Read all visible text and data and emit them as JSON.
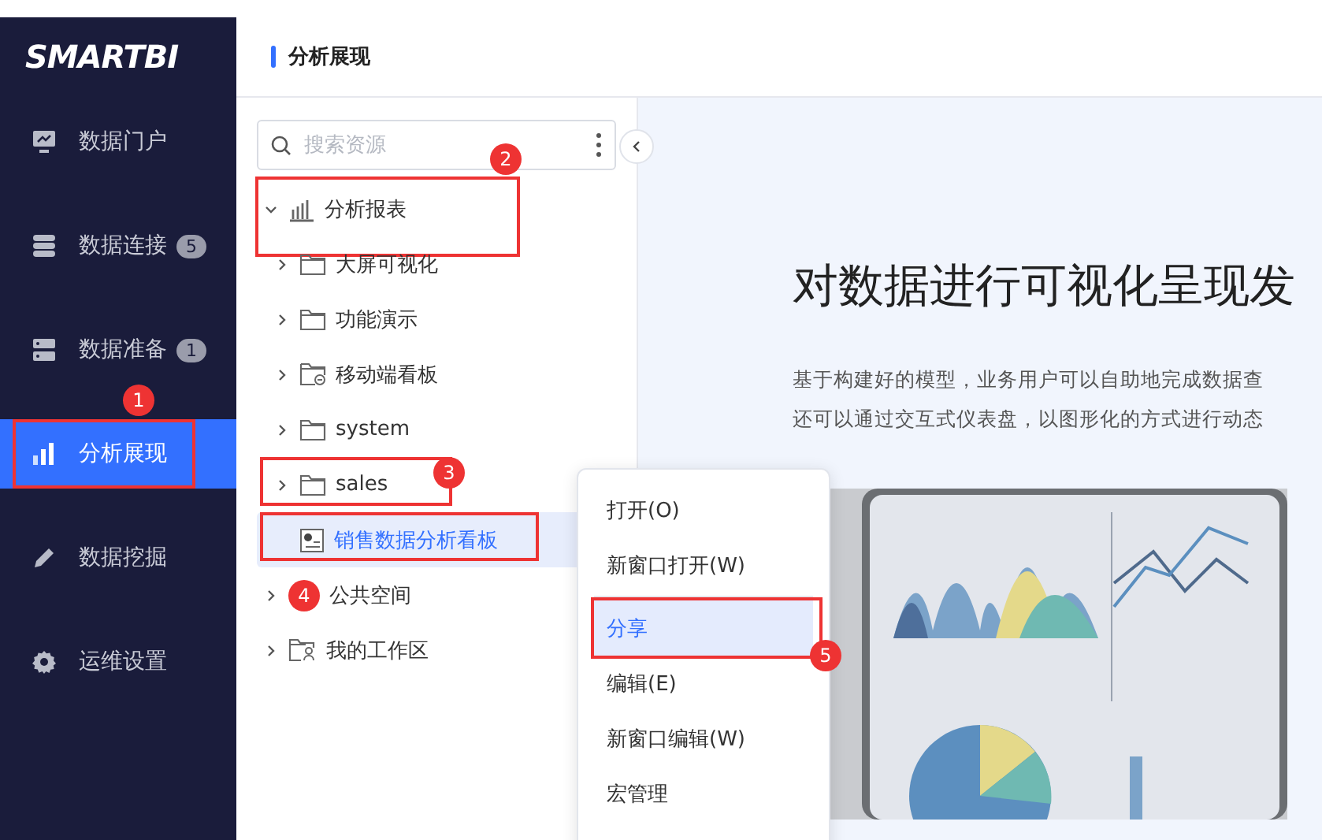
{
  "logo": "SMARTBI",
  "nav": [
    {
      "label": "数据门户",
      "kind": "monitor",
      "selected": false
    },
    {
      "label": "数据连接",
      "kind": "database",
      "count": "5",
      "selected": false
    },
    {
      "label": "数据准备",
      "kind": "server",
      "count": "1",
      "selected": false
    },
    {
      "label": "分析展现",
      "kind": "bars",
      "selected": true,
      "marked": true,
      "badge": "1"
    },
    {
      "label": "数据挖掘",
      "kind": "pen",
      "selected": false
    },
    {
      "label": "运维设置",
      "kind": "gear",
      "selected": false
    }
  ],
  "header": {
    "title": "分析展现"
  },
  "search": {
    "placeholder": "搜索资源"
  },
  "tree": [
    {
      "label": "分析报表",
      "kind": "report",
      "expanded": true,
      "selected": false,
      "marked": true,
      "badge": "2",
      "children": [
        {
          "label": "大屏可视化",
          "kind": "folder",
          "expanded": false,
          "selected": false
        },
        {
          "label": "功能演示",
          "kind": "folder",
          "expanded": false,
          "selected": false
        },
        {
          "label": "移动端看板",
          "kind": "mobile",
          "expanded": false,
          "selected": false
        },
        {
          "label": "system",
          "kind": "folder",
          "expanded": false,
          "selected": false
        },
        {
          "label": "sales",
          "kind": "folder",
          "expanded": false,
          "selected": false,
          "marked": true,
          "badge": "3"
        },
        {
          "label": "销售数据分析看板",
          "kind": "file",
          "selected": true,
          "marked": true
        }
      ]
    },
    {
      "label": "公共空间",
      "expanded": false,
      "selected": false,
      "badge": "4"
    },
    {
      "label": "我的工作区",
      "kind": "workspace",
      "expanded": false,
      "selected": false
    }
  ],
  "content": {
    "heading": "对数据进行可视化呈现发",
    "lines": [
      "基于构建好的模型，业务用户可以自助地完成数据查",
      "还可以通过交互式仪表盘，以图形化的方式进行动态"
    ],
    "kind": "picture"
  },
  "menu": [
    {
      "label": "打开(O)",
      "selected": false,
      "divider_before": false
    },
    {
      "label": "新窗口打开(W)",
      "selected": false,
      "divider_before": false
    },
    {
      "label": "分享",
      "selected": true,
      "divider_before": true,
      "marked": true,
      "badge": "5"
    },
    {
      "label": "编辑(E)",
      "selected": false,
      "divider_before": false
    },
    {
      "label": "新窗口编辑(W)",
      "selected": false,
      "divider_before": false
    },
    {
      "label": "宏管理",
      "selected": false,
      "divider_before": false
    }
  ]
}
